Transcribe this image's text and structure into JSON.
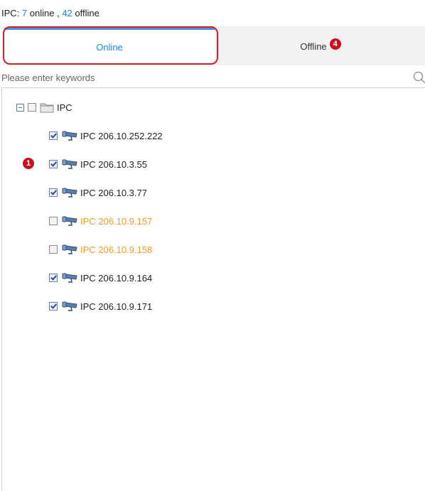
{
  "status": {
    "prefix": "IPC:",
    "online_count": "7",
    "online_word": "online ,",
    "offline_count": "42",
    "offline_word": "offline"
  },
  "tabs": {
    "online_label": "Online",
    "offline_label": "Offline",
    "offline_badge": "4"
  },
  "search": {
    "placeholder": "Please enter keywords",
    "value": ""
  },
  "tree": {
    "root_label": "IPC",
    "items": [
      {
        "label": "IPC 206.10.252.222",
        "checked": true,
        "state": "online"
      },
      {
        "label": "IPC 206.10.3.55",
        "checked": true,
        "state": "online"
      },
      {
        "label": "IPC 206.10.3.77",
        "checked": true,
        "state": "online"
      },
      {
        "label": "IPC 206.10.9.157",
        "checked": false,
        "state": "offline"
      },
      {
        "label": "IPC 206.10.9.158",
        "checked": false,
        "state": "offline"
      },
      {
        "label": "IPC 206.10.9.164",
        "checked": true,
        "state": "online"
      },
      {
        "label": "IPC 206.10.9.171",
        "checked": true,
        "state": "online"
      }
    ]
  },
  "markers": {
    "item_marker": "1"
  },
  "colors": {
    "accent": "#1f86d6",
    "offline_text": "#f39a2b",
    "badge": "#c8101e",
    "highlight_outline": "#cf1f2a"
  },
  "icons": {
    "search": "search-icon",
    "folder": "folder-icon",
    "camera": "camera-icon",
    "collapse": "collapse-icon"
  }
}
